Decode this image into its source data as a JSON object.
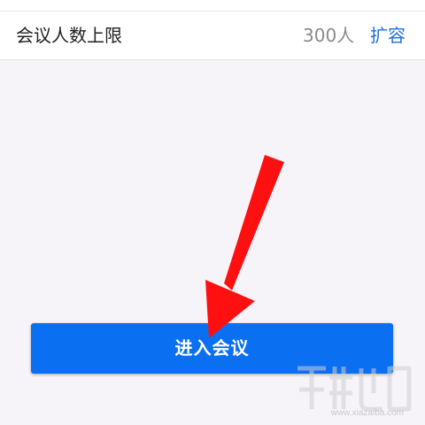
{
  "settings_row": {
    "label": "会议人数上限",
    "value": "300人",
    "action": "扩容"
  },
  "enter_button": {
    "label": "进入会议"
  },
  "annotation": {
    "arrow_color": "#ff0000"
  },
  "watermark": {
    "site_text": "www.xiazaiba.com"
  },
  "colors": {
    "background": "#f7f4f9",
    "button": "#0b6ff2",
    "link": "#1f6fe0"
  }
}
